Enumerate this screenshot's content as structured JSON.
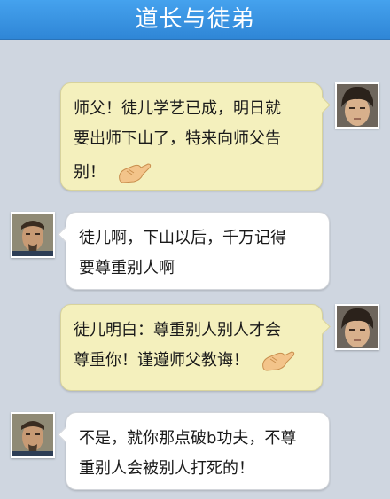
{
  "header": {
    "title": "道长与徒弟"
  },
  "messages": [
    {
      "sender": "disciple",
      "lines": [
        "师父！徒儿学艺已成，明日就",
        "要出师下山了，特来向师父告",
        "别！"
      ],
      "emoji": "fist-palm-salute-icon"
    },
    {
      "sender": "master",
      "lines": [
        "徒儿啊，下山以后，千万记得",
        "要尊重别人啊"
      ]
    },
    {
      "sender": "disciple",
      "lines": [
        "徒儿明白：尊重别人别人才会",
        "尊重你！谨遵师父教诲！"
      ],
      "emoji": "fist-palm-salute-icon"
    },
    {
      "sender": "master",
      "lines": [
        "不是，就你那点破b功夫，不尊",
        "重别人会被别人打死的！"
      ]
    }
  ],
  "colors": {
    "header": "#3a94e2",
    "background": "#cfd6e0",
    "disciple_bubble": "#f4f0bd",
    "master_bubble": "#ffffff"
  }
}
